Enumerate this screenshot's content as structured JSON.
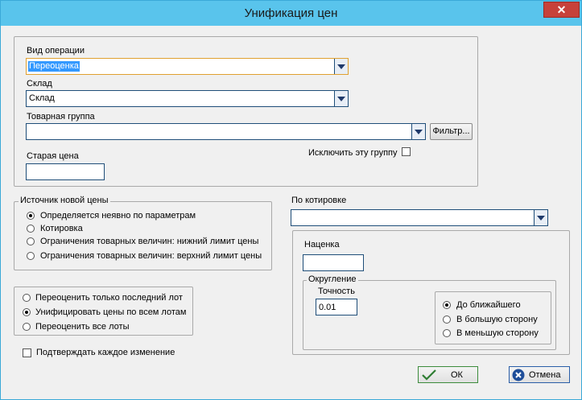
{
  "window": {
    "title": "Унификация цен",
    "close_glyph": "✕"
  },
  "operation": {
    "label": "Вид операции",
    "value": "Переоценка",
    "warehouse_label": "Склад",
    "warehouse_value": "Склад",
    "group_label": "Товарная группа",
    "group_value": "",
    "filter_button": "Фильтр...",
    "exclude_group_label": "Исключить эту группу",
    "exclude_group_checked": false,
    "old_price_label": "Старая цена",
    "old_price_value": ""
  },
  "new_price_source": {
    "legend": "Источник новой цены",
    "options": [
      {
        "label": "Определяется неявно по параметрам",
        "checked": true
      },
      {
        "label": "Котировка",
        "checked": false
      },
      {
        "label": "Ограничения товарных величин: нижний лимит цены",
        "checked": false
      },
      {
        "label": "Ограничения товарных величин: верхний лимит цены",
        "checked": false
      }
    ]
  },
  "lots": {
    "options": [
      {
        "label": "Переоценить только последний лот",
        "checked": false
      },
      {
        "label": "Унифицировать цены по всем лотам",
        "checked": true
      },
      {
        "label": "Переоценить все лоты",
        "checked": false
      }
    ]
  },
  "confirm_each": {
    "label": "Подтверждать каждое изменение",
    "checked": false
  },
  "quote": {
    "label": "По котировке",
    "value": ""
  },
  "markup": {
    "label": "Наценка",
    "value": "",
    "rounding_legend": "Округление",
    "precision_label": "Точность",
    "precision_value": "0.01",
    "rounding_options": [
      {
        "label": "До ближайшего",
        "checked": true
      },
      {
        "label": "В большую сторону",
        "checked": false
      },
      {
        "label": "В меньшую сторону",
        "checked": false
      }
    ]
  },
  "buttons": {
    "ok": "ОК",
    "cancel": "Отмена"
  },
  "colors": {
    "titlebar": "#59c4ec",
    "close": "#c7413a",
    "selection": "#3399ff",
    "ok_icon": "#2e7d32",
    "cancel_icon": "#1f4e99"
  }
}
